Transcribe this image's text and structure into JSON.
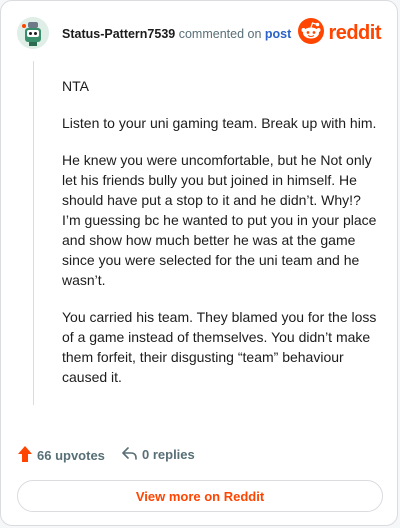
{
  "comment": {
    "username": "Status-Pattern7539",
    "action_text": "commented on",
    "post_link": "post",
    "paragraphs": [
      "NTA",
      "Listen to your uni gaming team. Break up with him.",
      "He knew you were uncomfortable, but he Not only let his friends bully you but joined in himself. He should have put a stop to it and he didn’t. Why!? I’m guessing bc he wanted to put you in your place and show how much better he was at the game since you were selected for the uni team and he wasn’t.",
      "You carried his team. They blamed you for the loss of a game instead of themselves. You didn’t make them forfeit, their disgusting “team” behaviour caused it."
    ]
  },
  "brand": {
    "logo_text": "reddit",
    "color": "#ff4500"
  },
  "footer": {
    "upvotes_label": "66 upvotes",
    "replies_label": "0 replies",
    "view_more_label": "View more on Reddit"
  },
  "icons": [
    "avatar",
    "reddit-snoo-icon",
    "upvote-arrow-icon",
    "reply-arrow-icon"
  ]
}
